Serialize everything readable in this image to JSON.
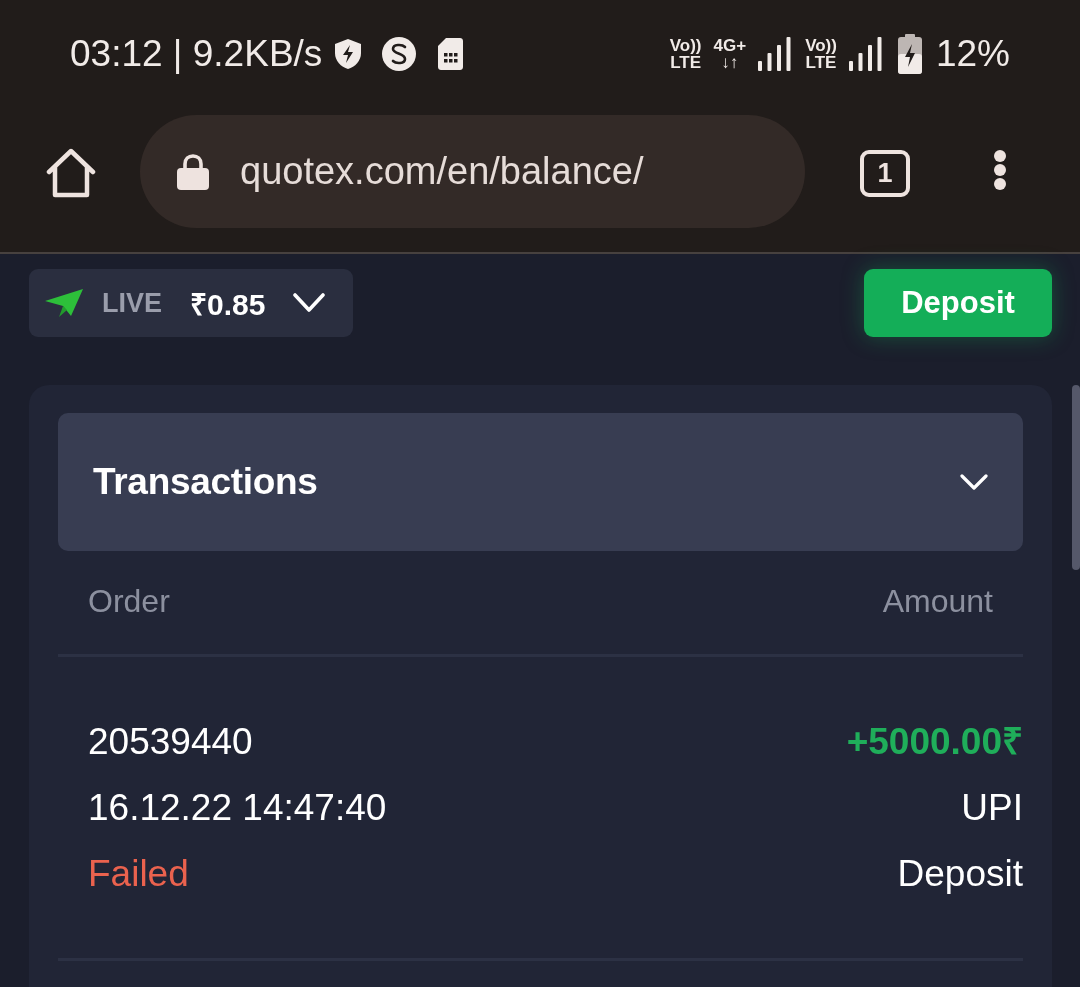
{
  "status_bar": {
    "time_speed": "03:12 | 9.2KB/s",
    "indicators": [
      {
        "kind": "volte",
        "top": "Vo))",
        "bottom": "LTE"
      },
      {
        "kind": "data",
        "top": "4G+",
        "bottom": "↓↑"
      },
      {
        "kind": "signal"
      },
      {
        "kind": "volte",
        "top": "Vo))",
        "bottom": "LTE"
      },
      {
        "kind": "signal"
      }
    ],
    "battery": "12%"
  },
  "browser": {
    "url": "quotex.com/en/balance/",
    "tab_count": "1"
  },
  "account": {
    "mode": "LIVE",
    "balance": "₹0.85"
  },
  "deposit_button": "Deposit",
  "transactions": {
    "title": "Transactions",
    "columns": [
      "Order",
      "Amount"
    ],
    "rows": [
      {
        "order": "20539440",
        "date": "16.12.22 14:47:40",
        "status": {
          "text": "Failed",
          "kind": "failed"
        },
        "amount": {
          "text": "+5000.00₹",
          "kind": "credit"
        },
        "method": "UPI",
        "type": "Deposit"
      }
    ]
  }
}
